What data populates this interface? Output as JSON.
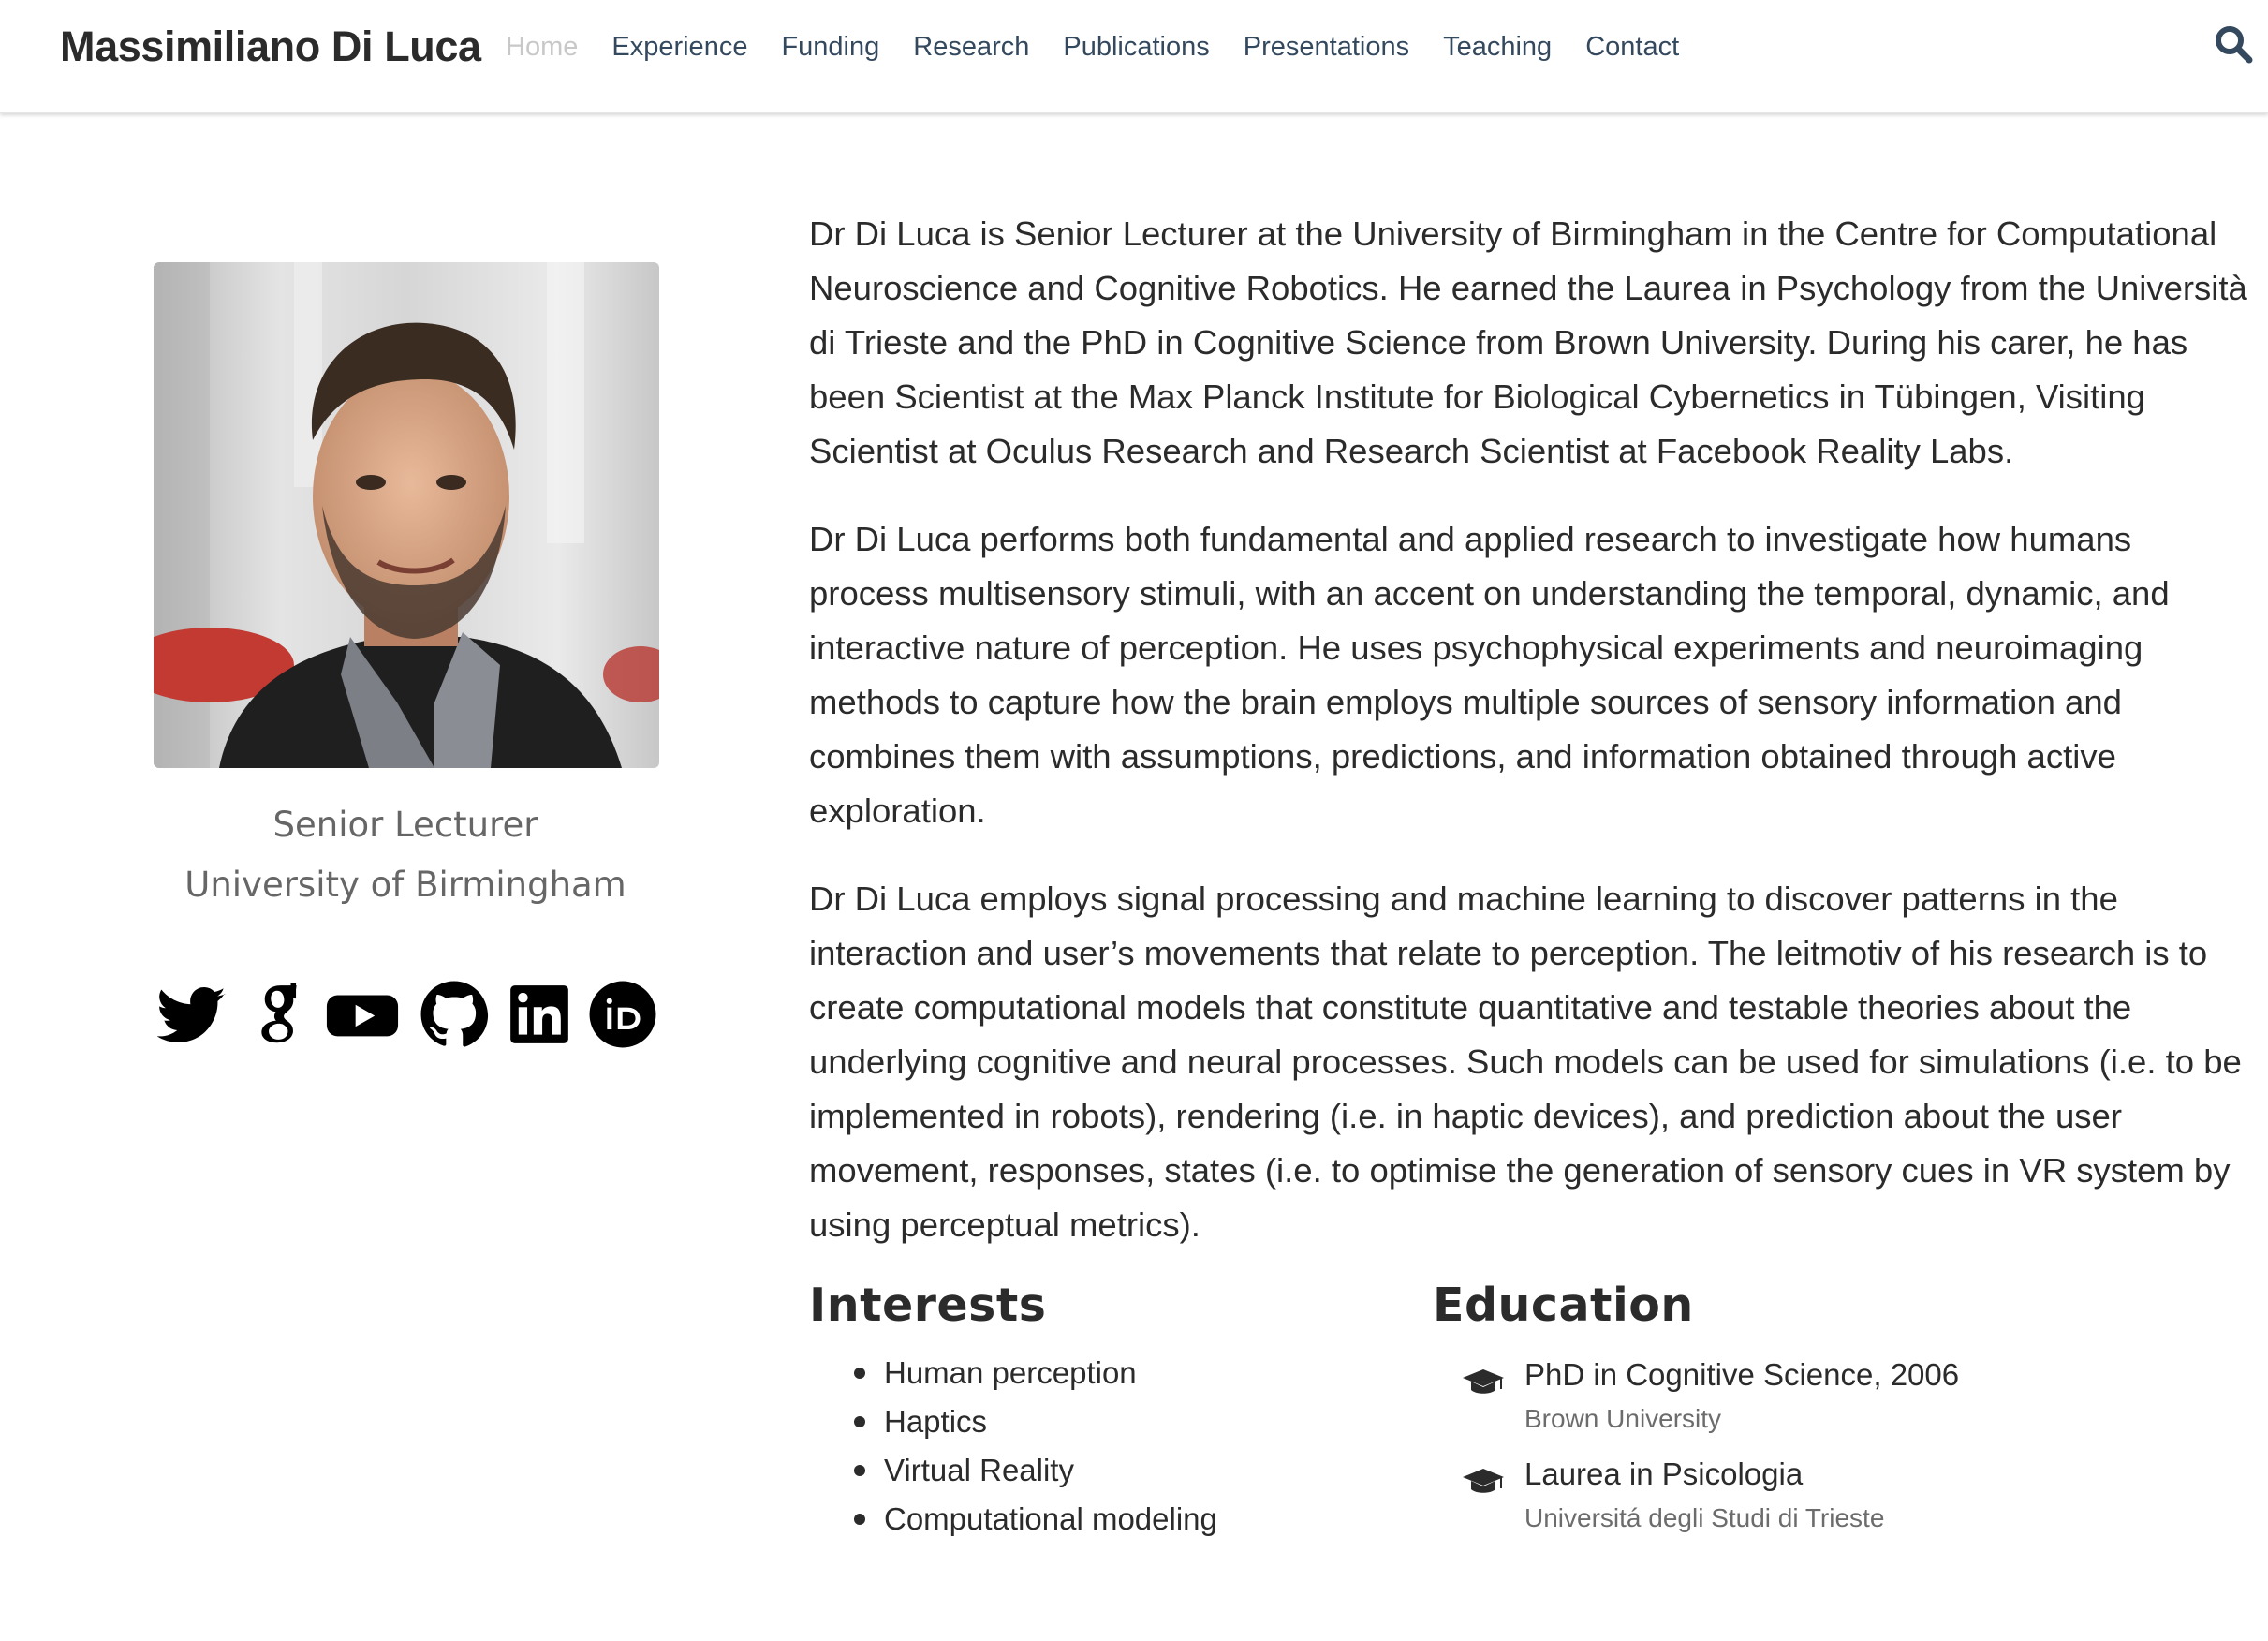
{
  "nav": {
    "brand": "Massimiliano Di Luca",
    "links": [
      "Home",
      "Experience",
      "Funding",
      "Research",
      "Publications",
      "Presentations",
      "Teaching",
      "Contact"
    ],
    "active_index": 0
  },
  "profile": {
    "role": "Senior Lecturer",
    "organization": "University of Birmingham",
    "social_icons": [
      "twitter-icon",
      "google-scholar-icon",
      "youtube-icon",
      "github-icon",
      "linkedin-icon",
      "orcid-icon"
    ]
  },
  "bio": {
    "paragraphs": [
      "Dr Di Luca is Senior Lecturer at the University of Birmingham in the Centre for Computational Neuroscience and Cognitive Robotics. He earned the Laurea in Psychology from the Università di Trieste and the PhD in Cognitive Science from Brown University. During his carer, he has been Scientist at the Max Planck Institute for Biological Cybernetics in Tübingen, Visiting Scientist at Oculus Research and Research Scientist at Facebook Reality Labs.",
      "Dr Di Luca performs both fundamental and applied research to investigate how humans process multisensory stimuli, with an accent on understanding the temporal, dynamic, and interactive nature of perception. He uses psychophysical experiments and neuroimaging methods to capture how the brain employs multiple sources of sensory information and combines them with assumptions, predictions, and information obtained through active exploration.",
      "Dr Di Luca employs signal processing and machine learning to discover patterns in the interaction and user’s movements that relate to perception. The leitmotiv of his research is to create computational models that constitute quantitative and testable theories about the underlying cognitive and neural processes. Such models can be used for simulations (i.e. to be implemented in robots), rendering (i.e. in haptic devices), and prediction about the user movement, responses, states (i.e. to optimise the generation of sensory cues in VR system by using perceptual metrics)."
    ]
  },
  "interests": {
    "title": "Interests",
    "items": [
      "Human perception",
      "Haptics",
      "Virtual Reality",
      "Computational modeling"
    ]
  },
  "education": {
    "title": "Education",
    "items": [
      {
        "course": "PhD in Cognitive Science, 2006",
        "institution": "Brown University"
      },
      {
        "course": "Laurea in Psicologia",
        "institution": "Universitá degli Studi di Trieste"
      }
    ]
  },
  "colors": {
    "text": "#2b2b2b",
    "nav_link": "#34495e",
    "nav_active": "#c8c8c8",
    "muted": "#666666"
  }
}
